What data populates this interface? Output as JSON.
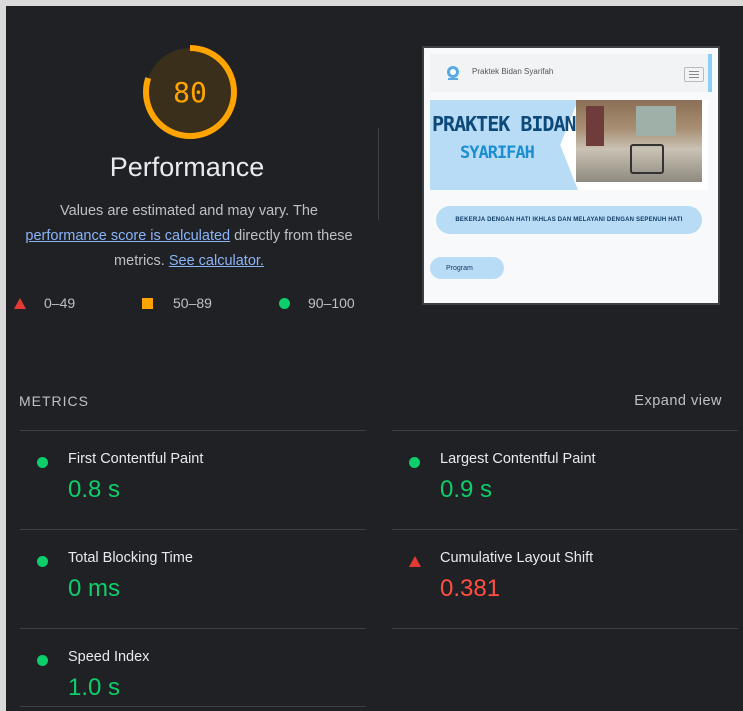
{
  "gauge": {
    "score": "80",
    "score_fraction": 0.8,
    "color": "#ffa400"
  },
  "performance": {
    "title": "Performance",
    "desc_line1": "Values are estimated and may vary. The",
    "link1": "performance score is calculated",
    "desc_mid": " directly from these",
    "desc_line3_start": "metrics. ",
    "link2": "See calculator."
  },
  "legend": [
    {
      "range": "0–49",
      "shape": "triangle",
      "color": "#e53935"
    },
    {
      "range": "50–89",
      "shape": "square",
      "color": "#ffa400"
    },
    {
      "range": "90–100",
      "shape": "circle",
      "color": "#0cce6b"
    }
  ],
  "screenshot": {
    "site_name": "Praktek Bidan Syarifah",
    "hero_line1": "PRAKTEK BIDAN",
    "hero_line2": "SYARIFAH",
    "tagline": "BEKERJA DENGAN HATI IKHLAS DAN MELAYANI DENGAN SEPENUH HATI",
    "button": "Program"
  },
  "metrics": {
    "heading": "METRICS",
    "expand": "Expand view",
    "items": [
      {
        "label": "First Contentful Paint",
        "value": "0.8 s",
        "status": "good"
      },
      {
        "label": "Largest Contentful Paint",
        "value": "0.9 s",
        "status": "good"
      },
      {
        "label": "Total Blocking Time",
        "value": "0 ms",
        "status": "good"
      },
      {
        "label": "Cumulative Layout Shift",
        "value": "0.381",
        "status": "bad"
      },
      {
        "label": "Speed Index",
        "value": "1.0 s",
        "status": "good"
      }
    ]
  },
  "colors": {
    "good": "#0cce6b",
    "average": "#ffa400",
    "poor": "#ff4e42",
    "link": "#8ab4f8",
    "background": "#202124"
  }
}
